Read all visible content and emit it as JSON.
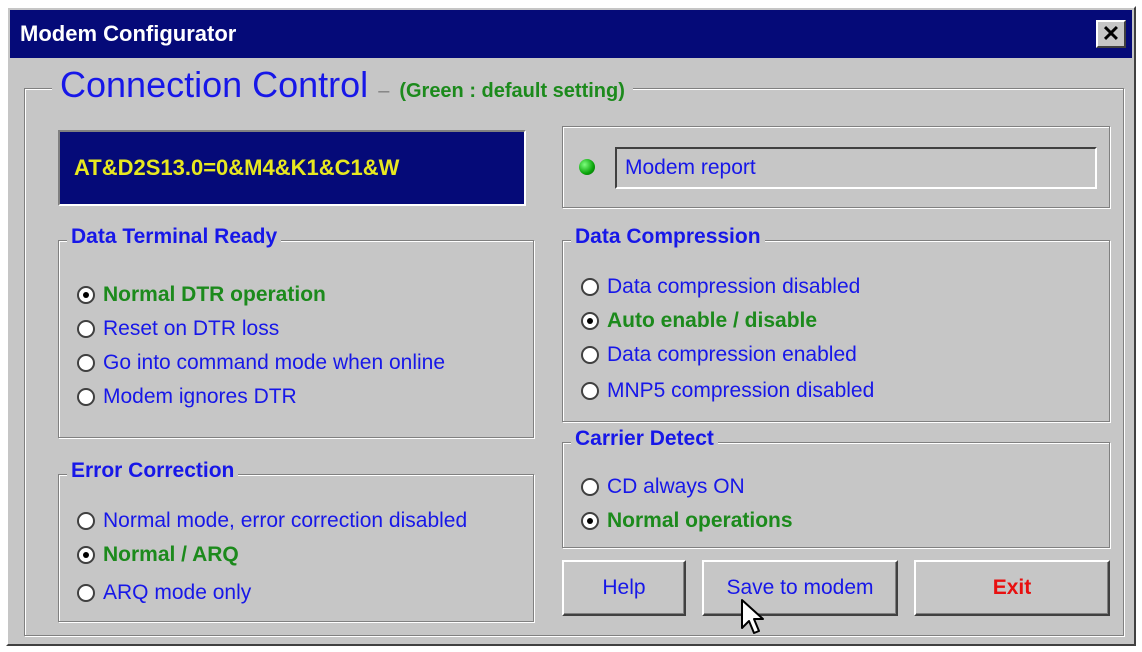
{
  "window": {
    "title": "Modem Configurator",
    "close_glyph": "✕"
  },
  "header": {
    "title": "Connection Control",
    "separator": "–",
    "note": "(Green : default setting)"
  },
  "at_command": "AT&D2S13.0=0&M4&K1&C1&W",
  "report": {
    "text": "Modem report",
    "led_color": "#0aa40a"
  },
  "dtr": {
    "title": "Data Terminal Ready",
    "options": [
      {
        "label": "Normal DTR operation",
        "checked": true,
        "default": true
      },
      {
        "label": "Reset on DTR loss",
        "checked": false,
        "default": false
      },
      {
        "label": "Go into command mode when online",
        "checked": false,
        "default": false
      },
      {
        "label": "Modem ignores DTR",
        "checked": false,
        "default": false
      }
    ]
  },
  "error_correction": {
    "title": "Error Correction",
    "options": [
      {
        "label": "Normal mode, error correction disabled",
        "checked": false,
        "default": false
      },
      {
        "label": "Normal / ARQ",
        "checked": true,
        "default": true
      },
      {
        "label": "ARQ mode only",
        "checked": false,
        "default": false
      }
    ]
  },
  "compression": {
    "title": "Data Compression",
    "options": [
      {
        "label": "Data compression disabled",
        "checked": false,
        "default": false
      },
      {
        "label": "Auto enable / disable",
        "checked": true,
        "default": true
      },
      {
        "label": "Data compression enabled",
        "checked": false,
        "default": false
      },
      {
        "label": "MNP5 compression disabled",
        "checked": false,
        "default": false
      }
    ]
  },
  "carrier": {
    "title": "Carrier Detect",
    "options": [
      {
        "label": "CD always ON",
        "checked": false,
        "default": false
      },
      {
        "label": "Normal operations",
        "checked": true,
        "default": true
      }
    ]
  },
  "buttons": {
    "help": "Help",
    "save": "Save to modem",
    "exit": "Exit"
  },
  "colors": {
    "title_bar": "#050a78",
    "label_blue": "#1717e8",
    "default_green": "#1c8a1c",
    "exit_red": "#e81010",
    "at_text": "#e8e820"
  }
}
